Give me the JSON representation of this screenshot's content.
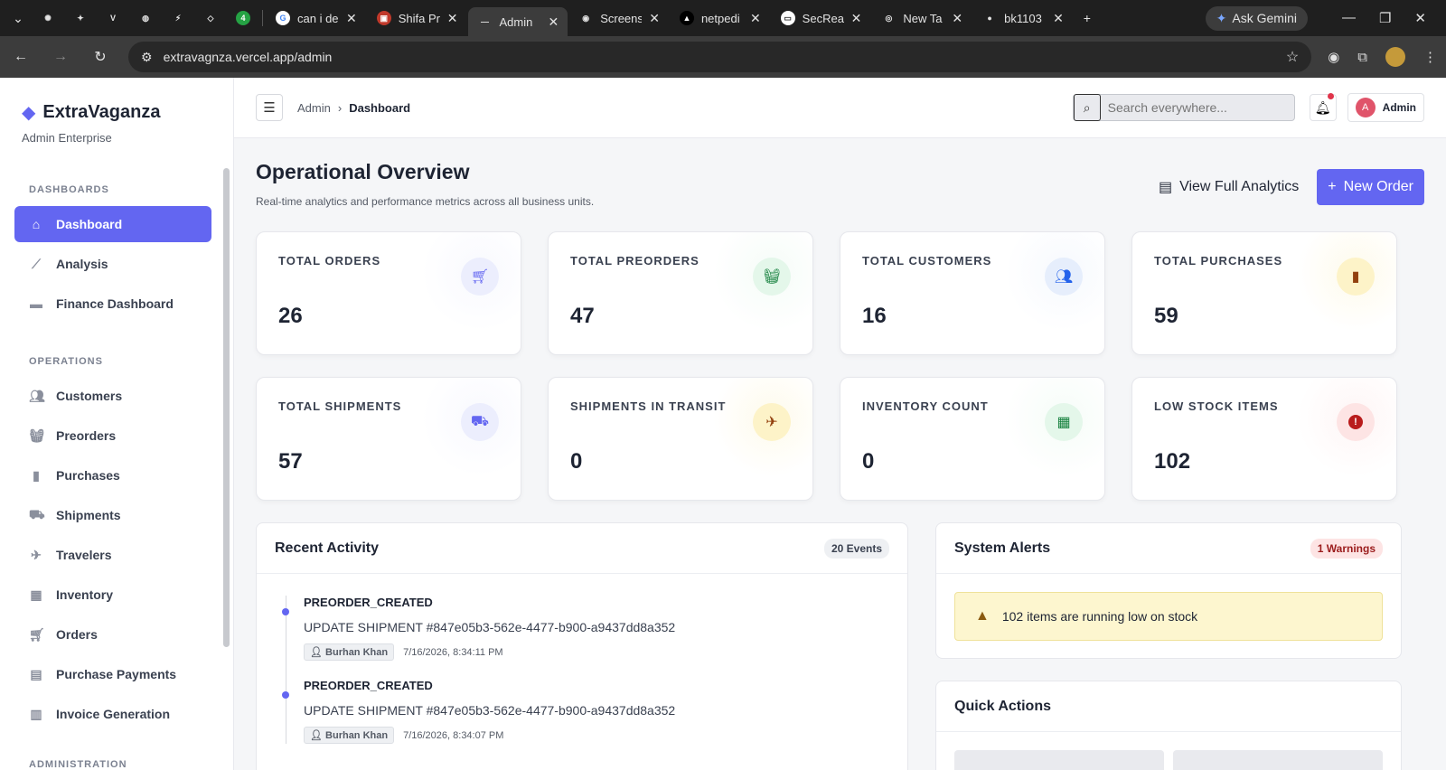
{
  "browser": {
    "tabs": [
      {
        "label": "",
        "pinned": true,
        "icon": "chatgpt-icon"
      },
      {
        "label": "",
        "pinned": true,
        "icon": "gemini-icon"
      },
      {
        "label": "",
        "pinned": true,
        "icon": "v-icon"
      },
      {
        "label": "",
        "pinned": true,
        "icon": "globe-icon"
      },
      {
        "label": "",
        "pinned": true,
        "icon": "bolt-icon"
      },
      {
        "label": "",
        "pinned": true,
        "icon": "azure-icon"
      },
      {
        "label": "4",
        "pinned": true,
        "icon": "whatsapp-icon"
      },
      {
        "label": "can i de",
        "icon": "google-icon"
      },
      {
        "label": "Shifa Pr",
        "icon": "pdf-icon"
      },
      {
        "label": "Admin",
        "icon": "vercel-icon",
        "active": true
      },
      {
        "label": "Screens",
        "icon": "camera-icon"
      },
      {
        "label": "netpedi",
        "icon": "triangle-icon"
      },
      {
        "label": "SecReal",
        "icon": "doc-icon"
      },
      {
        "label": "New Ta",
        "icon": "chrome-icon"
      },
      {
        "label": "bk1103",
        "icon": "github-icon"
      }
    ],
    "ask_gemini": "Ask Gemini",
    "url": "extravagnza.vercel.app/admin"
  },
  "sidebar": {
    "brand": "ExtraVaganza",
    "brand_sub": "Admin Enterprise",
    "sections": {
      "dashboards": "DASHBOARDS",
      "operations": "OPERATIONS",
      "administration": "ADMINISTRATION"
    },
    "dashboards": [
      {
        "label": "Dashboard",
        "icon": "home-icon",
        "active": true
      },
      {
        "label": "Analysis",
        "icon": "line-chart-icon"
      },
      {
        "label": "Finance Dashboard",
        "icon": "wallet-icon"
      }
    ],
    "operations": [
      {
        "label": "Customers",
        "icon": "users-icon"
      },
      {
        "label": "Preorders",
        "icon": "basket-icon"
      },
      {
        "label": "Purchases",
        "icon": "bag-icon"
      },
      {
        "label": "Shipments",
        "icon": "truck-icon"
      },
      {
        "label": "Travelers",
        "icon": "plane-icon"
      },
      {
        "label": "Inventory",
        "icon": "boxes-icon"
      },
      {
        "label": "Orders",
        "icon": "cart-icon"
      },
      {
        "label": "Purchase Payments",
        "icon": "receipt-icon"
      },
      {
        "label": "Invoice Generation",
        "icon": "invoice-icon"
      }
    ]
  },
  "topbar": {
    "breadcrumb_root": "Admin",
    "breadcrumb_current": "Dashboard",
    "search_placeholder": "Search everywhere...",
    "user_initial": "A",
    "user_name": "Admin"
  },
  "overview": {
    "title": "Operational Overview",
    "subtitle": "Real-time analytics and performance metrics across all business units.",
    "view_analytics": "View Full Analytics",
    "new_order": "New Order"
  },
  "stats": [
    {
      "label": "TOTAL ORDERS",
      "value": "26",
      "icon": "cart-icon",
      "color": "#6366f1",
      "bg": "#eceefd"
    },
    {
      "label": "TOTAL PREORDERS",
      "value": "47",
      "icon": "basket-icon",
      "color": "#15803d",
      "bg": "#e4f7ea"
    },
    {
      "label": "TOTAL CUSTOMERS",
      "value": "16",
      "icon": "users-icon",
      "color": "#2563eb",
      "bg": "#e6eefc"
    },
    {
      "label": "TOTAL PURCHASES",
      "value": "59",
      "icon": "bag-icon",
      "color": "#92400e",
      "bg": "#fdf3c8"
    },
    {
      "label": "TOTAL SHIPMENTS",
      "value": "57",
      "icon": "truck-icon",
      "color": "#6366f1",
      "bg": "#eceefd"
    },
    {
      "label": "SHIPMENTS IN TRANSIT",
      "value": "0",
      "icon": "plane-icon",
      "color": "#92400e",
      "bg": "#fdf3c8"
    },
    {
      "label": "INVENTORY COUNT",
      "value": "0",
      "icon": "boxes-icon",
      "color": "#15803d",
      "bg": "#e4f7ea"
    },
    {
      "label": "LOW STOCK ITEMS",
      "value": "102",
      "icon": "alert-circle-icon",
      "color": "#b91c1c",
      "bg": "#fde4e4"
    }
  ],
  "activity": {
    "title": "Recent Activity",
    "badge": "20 Events",
    "events": [
      {
        "type": "PREORDER_CREATED",
        "desc": "UPDATE SHIPMENT #847e05b3-562e-4477-b900-a9437dd8a352",
        "user": "Burhan Khan",
        "time": "7/16/2026, 8:34:11 PM"
      },
      {
        "type": "PREORDER_CREATED",
        "desc": "UPDATE SHIPMENT #847e05b3-562e-4477-b900-a9437dd8a352",
        "user": "Burhan Khan",
        "time": "7/16/2026, 8:34:07 PM"
      }
    ]
  },
  "alerts": {
    "title": "System Alerts",
    "badge": "1 Warnings",
    "message": "102 items are running low on stock"
  },
  "quick_actions": {
    "title": "Quick Actions"
  }
}
